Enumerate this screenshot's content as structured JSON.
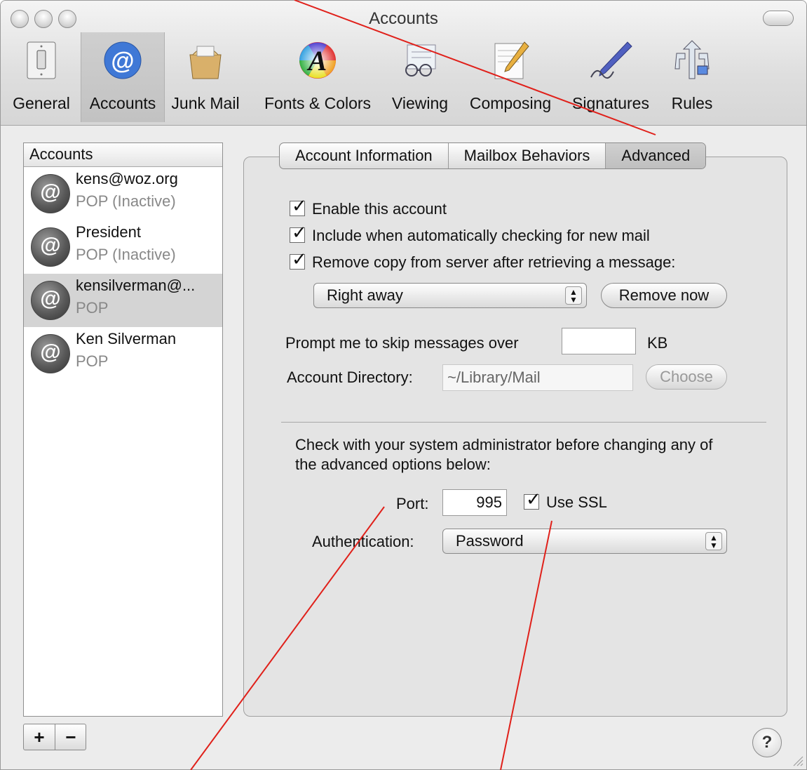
{
  "window": {
    "title": "Accounts"
  },
  "toolbar": {
    "items": [
      {
        "label": "General",
        "icon": "light-switch-icon"
      },
      {
        "label": "Accounts",
        "icon": "at-sign-icon"
      },
      {
        "label": "Junk Mail",
        "icon": "junk-mail-bag-icon"
      },
      {
        "label": "Fonts & Colors",
        "icon": "font-color-wheel-icon"
      },
      {
        "label": "Viewing",
        "icon": "glasses-icon"
      },
      {
        "label": "Composing",
        "icon": "notepad-pencil-icon"
      },
      {
        "label": "Signatures",
        "icon": "pen-signature-icon"
      },
      {
        "label": "Rules",
        "icon": "rules-arrows-icon"
      }
    ],
    "selected": "Accounts"
  },
  "sidebar": {
    "header": "Accounts",
    "accounts": [
      {
        "name": "kens@woz.org",
        "type": "POP (Inactive)"
      },
      {
        "name": "President",
        "type": "POP (Inactive)"
      },
      {
        "name": "kensilverman@...",
        "type": "POP",
        "selected": true
      },
      {
        "name": "Ken Silverman",
        "type": "POP"
      }
    ],
    "add_label": "+",
    "remove_label": "−"
  },
  "tabs": {
    "items": [
      "Account Information",
      "Mailbox Behaviors",
      "Advanced"
    ],
    "active": "Advanced"
  },
  "advanced": {
    "enable_account": {
      "label": "Enable this account",
      "checked": true
    },
    "include_checking": {
      "label": "Include when automatically checking for new mail",
      "checked": true
    },
    "remove_copy": {
      "label": "Remove copy from server after retrieving a message:",
      "checked": true
    },
    "remove_when": "Right away",
    "remove_now_label": "Remove now",
    "skip_label": "Prompt me to skip messages over",
    "skip_value": "",
    "skip_unit": "KB",
    "directory_label": "Account Directory:",
    "directory_value": "~/Library/Mail",
    "choose_label": "Choose",
    "warning_line1": "Check with your system administrator before changing any of",
    "warning_line2": "the advanced options below:",
    "port_label": "Port:",
    "port_value": "995",
    "ssl": {
      "label": "Use SSL",
      "checked": true
    },
    "auth_label": "Authentication:",
    "auth_value": "Password"
  },
  "help_label": "?",
  "colors": {
    "annotation": "#e0201a",
    "selected_row": "#d4d4d4"
  }
}
